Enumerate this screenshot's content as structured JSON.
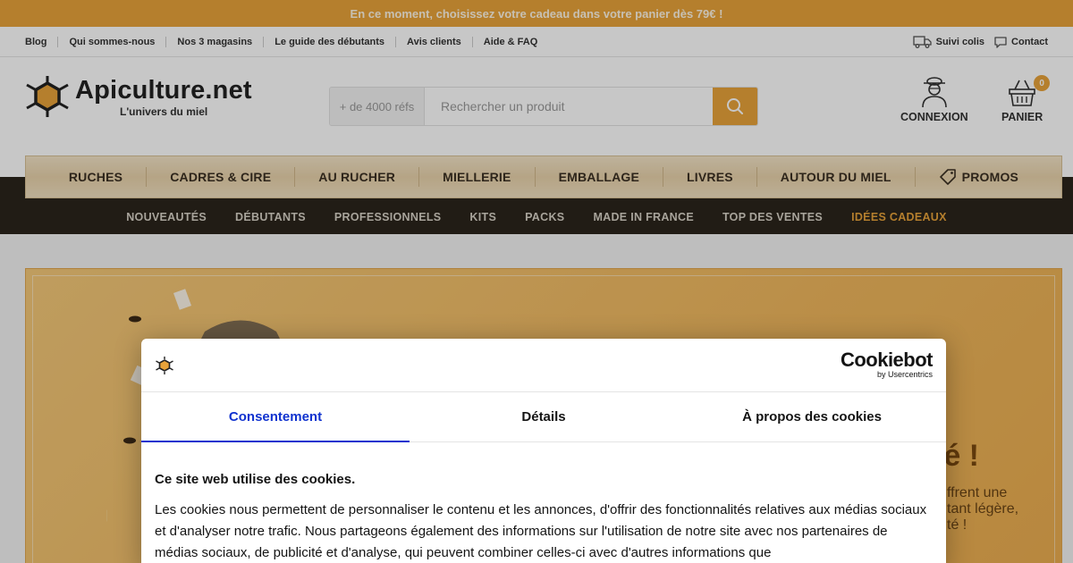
{
  "promo": {
    "text": "En ce moment, choisissez votre cadeau dans votre panier dès 79€ !"
  },
  "top_links": {
    "left": [
      "Blog",
      "Qui sommes-nous",
      "Nos 3 magasins",
      "Le guide des débutants",
      "Avis clients",
      "Aide & FAQ"
    ],
    "tracking": "Suivi colis",
    "contact": "Contact"
  },
  "logo": {
    "title": "Apiculture.net",
    "subtitle": "L'univers du miel"
  },
  "search": {
    "refs": "+ de 4000 réfs",
    "placeholder": "Rechercher un produit"
  },
  "account": {
    "login": "CONNEXION",
    "cart": "PANIER",
    "cart_count": "0"
  },
  "main_nav": [
    "RUCHES",
    "CADRES & CIRE",
    "AU RUCHER",
    "MIELLERIE",
    "EMBALLAGE",
    "LIVRES",
    "AUTOUR DU MIEL",
    "PROMOS"
  ],
  "sub_nav": [
    "NOUVEAUTÉS",
    "DÉBUTANTS",
    "PROFESSIONNELS",
    "KITS",
    "PACKS",
    "MADE IN FRANCE",
    "TOP DES VENTES",
    "IDÉES CADEAUX"
  ],
  "banner": {
    "headline": "té !",
    "blurb_1": "ffrent une",
    "blurb_2": "tant légère,",
    "blurb_3": "té !"
  },
  "cookie": {
    "brand": "Cookiebot",
    "brand_sub": "by Usercentrics",
    "tabs": [
      "Consentement",
      "Détails",
      "À propos des cookies"
    ],
    "heading": "Ce site web utilise des cookies.",
    "text": "Les cookies nous permettent de personnaliser le contenu et les annonces, d'offrir des fonctionnalités relatives aux médias sociaux et d'analyser notre trafic. Nous partageons également des informations sur l'utilisation de notre site avec nos partenaires de médias sociaux, de publicité et d'analyse, qui peuvent combiner celles-ci avec d'autres informations que"
  },
  "colors": {
    "accent": "#e8a33a",
    "nav_dark": "#2b241b",
    "cookie_blue": "#1032cf"
  }
}
